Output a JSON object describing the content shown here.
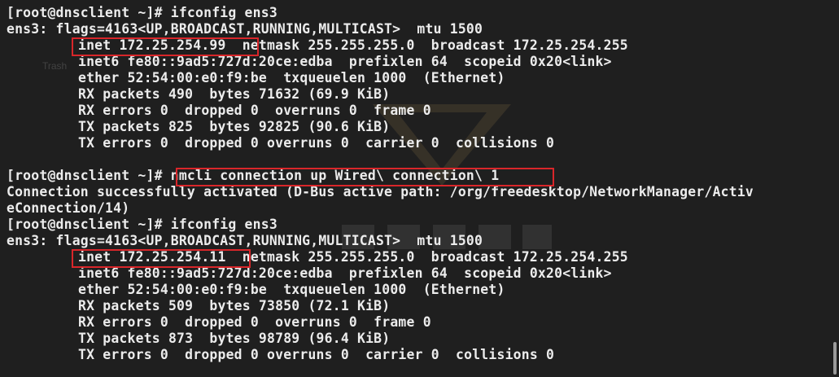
{
  "desktop": {
    "trash_label": "Trash"
  },
  "terminal": {
    "lines": [
      {
        "indent": false,
        "text": "[root@dnsclient ~]# ifconfig ens3"
      },
      {
        "indent": false,
        "text": "ens3: flags=4163<UP,BROADCAST,RUNNING,MULTICAST>  mtu 1500"
      },
      {
        "indent": true,
        "text": "inet 172.25.254.99  netmask 255.255.255.0  broadcast 172.25.254.255"
      },
      {
        "indent": true,
        "text": "inet6 fe80::9ad5:727d:20ce:edba  prefixlen 64  scopeid 0x20<link>"
      },
      {
        "indent": true,
        "text": "ether 52:54:00:e0:f9:be  txqueuelen 1000  (Ethernet)"
      },
      {
        "indent": true,
        "text": "RX packets 490  bytes 71632 (69.9 KiB)"
      },
      {
        "indent": true,
        "text": "RX errors 0  dropped 0  overruns 0  frame 0"
      },
      {
        "indent": true,
        "text": "TX packets 825  bytes 92825 (90.6 KiB)"
      },
      {
        "indent": true,
        "text": "TX errors 0  dropped 0 overruns 0  carrier 0  collisions 0"
      },
      {
        "indent": false,
        "text": ""
      },
      {
        "indent": false,
        "text": "[root@dnsclient ~]# nmcli connection up Wired\\ connection\\ 1"
      },
      {
        "indent": false,
        "text": "Connection successfully activated (D-Bus active path: /org/freedesktop/NetworkManager/Activ"
      },
      {
        "indent": false,
        "text": "eConnection/14)"
      },
      {
        "indent": false,
        "text": "[root@dnsclient ~]# ifconfig ens3"
      },
      {
        "indent": false,
        "text": "ens3: flags=4163<UP,BROADCAST,RUNNING,MULTICAST>  mtu 1500"
      },
      {
        "indent": true,
        "text": "inet 172.25.254.11  netmask 255.255.255.0  broadcast 172.25.254.255"
      },
      {
        "indent": true,
        "text": "inet6 fe80::9ad5:727d:20ce:edba  prefixlen 64  scopeid 0x20<link>"
      },
      {
        "indent": true,
        "text": "ether 52:54:00:e0:f9:be  txqueuelen 1000  (Ethernet)"
      },
      {
        "indent": true,
        "text": "RX packets 509  bytes 73850 (72.1 KiB)"
      },
      {
        "indent": true,
        "text": "RX errors 0  dropped 0  overruns 0  frame 0"
      },
      {
        "indent": true,
        "text": "TX packets 873  bytes 98789 (96.4 KiB)"
      },
      {
        "indent": true,
        "text": "TX errors 0  dropped 0 overruns 0  carrier 0  collisions 0"
      }
    ]
  },
  "colors": {
    "background": "#1f1f1f",
    "text": "#ececec",
    "highlight_border": "#d9262a"
  }
}
